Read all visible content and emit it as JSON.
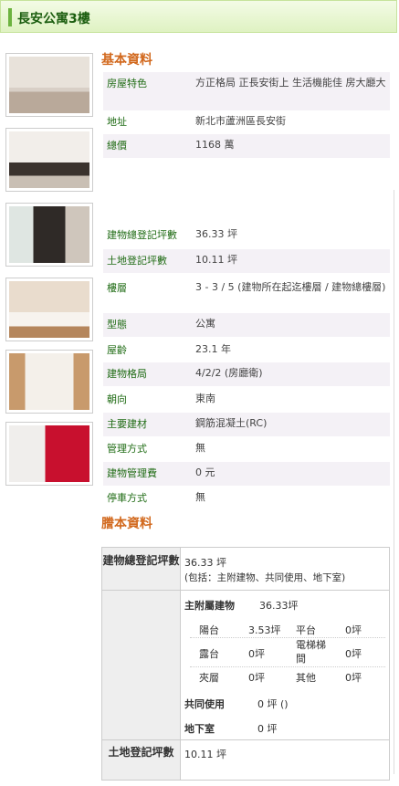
{
  "page_title": "長安公寓3樓",
  "sections": {
    "basic": "基本資料",
    "transcript": "謄本資料"
  },
  "basic_info": [
    {
      "key": "房屋特色",
      "value": "方正格局 正長安街上 生活機能佳 房大廳大"
    },
    {
      "key": "地址",
      "value": "新北市蘆洲區長安街"
    },
    {
      "key": "總價",
      "value": "1168 萬"
    },
    {
      "key": "建物總登記坪數",
      "value": "36.33 坪"
    },
    {
      "key": "土地登記坪數",
      "value": "10.11 坪"
    },
    {
      "key": "樓層",
      "value": "3 - 3 / 5 (建物所在起迄樓層 / 建物總樓層)"
    },
    {
      "key": "型態",
      "value": "公寓"
    },
    {
      "key": "屋齡",
      "value": "23.1 年"
    },
    {
      "key": "建物格局",
      "value": "4/2/2 (房廳衛)"
    },
    {
      "key": "朝向",
      "value": "東南"
    },
    {
      "key": "主要建材",
      "value": "鋼筋混凝土(RC)"
    },
    {
      "key": "管理方式",
      "value": "無"
    },
    {
      "key": "建物管理費",
      "value": "0 元"
    },
    {
      "key": "停車方式",
      "value": "無"
    }
  ],
  "transcript": {
    "building_label": "建物總登記坪數",
    "building_value": "36.33 坪",
    "building_note": "(包括：主附建物、共同使用、地下室)",
    "main_label": "主附屬建物",
    "main_value": "36.33坪",
    "items": [
      {
        "k": "陽台",
        "v": "3.53坪"
      },
      {
        "k": "平台",
        "v": "0坪"
      },
      {
        "k": "露台",
        "v": "0坪"
      },
      {
        "k": "電梯梯間",
        "v": "0坪"
      },
      {
        "k": "夾層",
        "v": "0坪"
      },
      {
        "k": "其他",
        "v": "0坪"
      }
    ],
    "shared_label": "共同使用",
    "shared_value": "0 坪 ()",
    "basement_label": "地下室",
    "basement_value": "0 坪",
    "land_label": "土地登記坪數",
    "land_value": "10.11 坪"
  }
}
